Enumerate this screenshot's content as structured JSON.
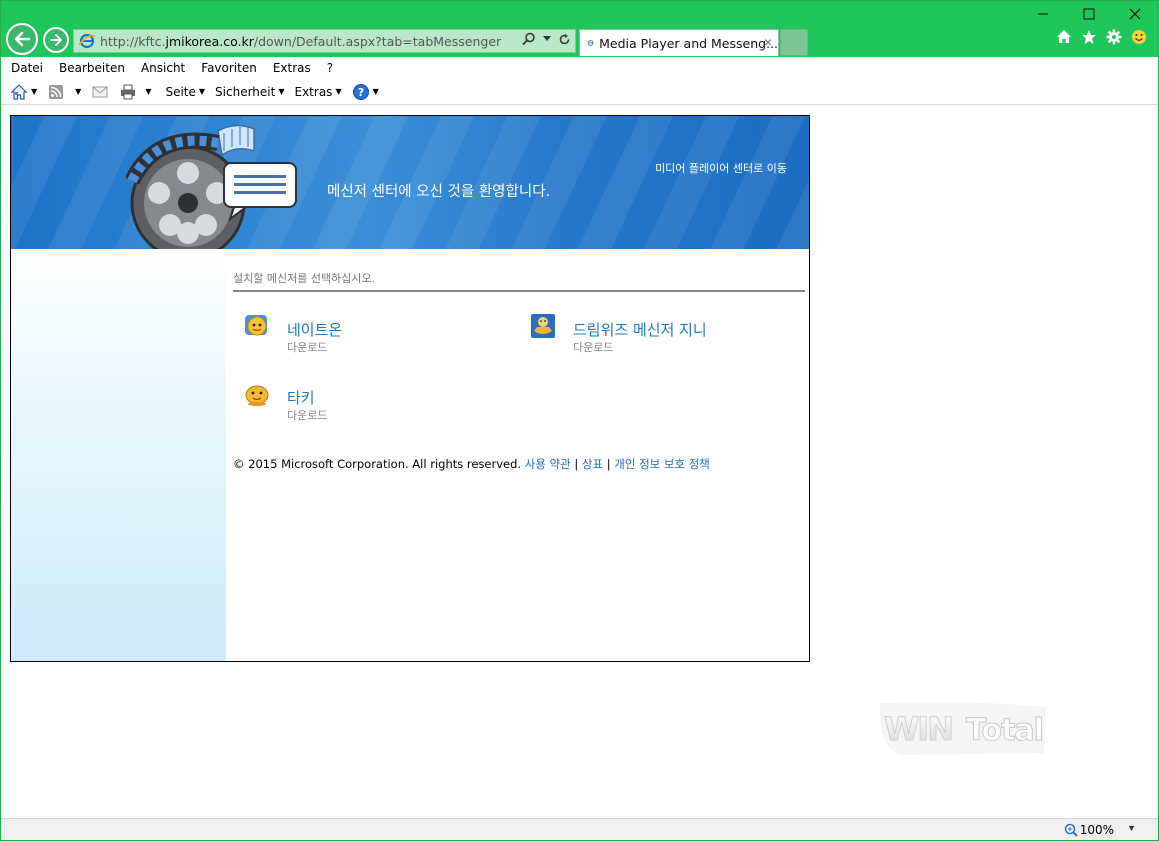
{
  "browser": {
    "address": {
      "scheme": "http://",
      "sub": "kftc.",
      "host": "jmikorea.co.kr",
      "path": "/down/Default.aspx?tab=tabMessenger"
    },
    "tab_title": "Media Player and Messeng...",
    "tab_close": "×",
    "menu": [
      "Datei",
      "Bearbeiten",
      "Ansicht",
      "Favoriten",
      "Extras",
      "?"
    ],
    "commands": {
      "seite": "Seite",
      "sicherheit": "Sicherheit",
      "extras": "Extras"
    },
    "zoom": "100%"
  },
  "page": {
    "banner_welcome": "메신저 센터에 오신 것을 환영합니다.",
    "banner_link": "미디어 플레이어 센터로 이동",
    "instruction": "설치할 메신저를 선택하십시오.",
    "items": [
      {
        "name": "네이트온",
        "action": "다운로드"
      },
      {
        "name": "드림위즈 메신저 지니",
        "action": "다운로드"
      },
      {
        "name": "타키",
        "action": "다운로드"
      }
    ],
    "footer": {
      "copyright": "© 2015 Microsoft Corporation. All rights reserved.",
      "terms": "사용 약관",
      "sep1": "|",
      "trademark": "상표",
      "sep2": "|",
      "privacy": "개인 정보 보호 정책"
    }
  },
  "watermark": "WIN Total",
  "colors": {
    "titlebar": "#21c65a",
    "banner": "#2b82d0",
    "link": "#1f78c1"
  }
}
